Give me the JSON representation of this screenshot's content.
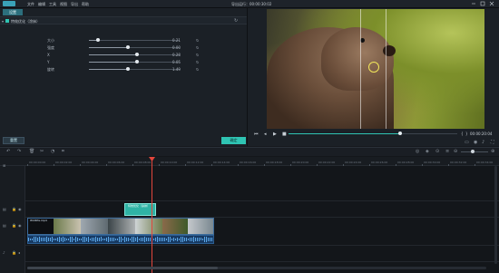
{
  "app": {
    "menu": [
      "文件",
      "编辑",
      "工具",
      "视图",
      "导出",
      "帮助"
    ],
    "project_title": "导出运行：00:00:30:02"
  },
  "left_panel": {
    "tab_label": "设置",
    "section_label": "特效优化（涂抹）",
    "properties": [
      {
        "label": "大小",
        "value": "0.21",
        "level": 0.1
      },
      {
        "label": "强度",
        "value": "0.00",
        "level": 0.43
      },
      {
        "label": "X",
        "value": "0.28",
        "level": 0.53
      },
      {
        "label": "Y",
        "value": "0.05",
        "level": 0.53
      },
      {
        "label": "旋转",
        "value": "1.49",
        "level": 0.43
      }
    ],
    "reset_label": "重置",
    "ok_label": "确定"
  },
  "preview": {
    "timecode": "00:00:20:04",
    "progress": 0.66
  },
  "timeline": {
    "ruler_labels": [
      "00:00:00:00",
      "00:00:02:00",
      "00:00:04:00",
      "00:00:06:00",
      "00:00:08:00",
      "00:00:10:00",
      "00:00:12:00",
      "00:00:14:00",
      "00:00:16:00",
      "00:00:18:00",
      "00:00:20:00",
      "00:00:22:00",
      "00:00:24:00",
      "00:00:26:00",
      "00:00:28:00",
      "00:00:30:00",
      "00:00:32:00",
      "00:00:34:00"
    ],
    "effect_clip_label": "特效优化（涂抹）",
    "video_clip_label": "Wildlife.mp4"
  },
  "colors": {
    "accent": "#2fc4b3",
    "playhead": "#e3463c",
    "clip": "#1e3550"
  }
}
